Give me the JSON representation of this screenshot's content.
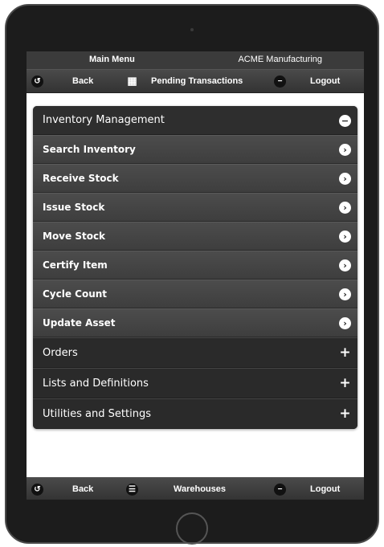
{
  "header": {
    "main_menu": "Main Menu",
    "company": "ACME Manufacturing"
  },
  "top_nav": {
    "back": "Back",
    "pending": "Pending Transactions",
    "logout": "Logout"
  },
  "menu": {
    "section": "Inventory Management",
    "items": [
      {
        "label": "Search Inventory"
      },
      {
        "label": "Receive Stock"
      },
      {
        "label": "Issue Stock"
      },
      {
        "label": "Move Stock"
      },
      {
        "label": "Certify Item"
      },
      {
        "label": "Cycle Count"
      },
      {
        "label": "Update Asset"
      }
    ],
    "collapsed": [
      {
        "label": "Orders"
      },
      {
        "label": "Lists and Definitions"
      },
      {
        "label": "Utilities and Settings"
      }
    ]
  },
  "bottom_nav": {
    "back": "Back",
    "warehouses": "Warehouses",
    "logout": "Logout"
  },
  "icons": {
    "back": "back-arrow-icon",
    "grid": "grid-icon",
    "list": "list-icon",
    "minus": "minus-icon",
    "chevron": "chevron-right-icon",
    "plus": "plus-icon"
  }
}
